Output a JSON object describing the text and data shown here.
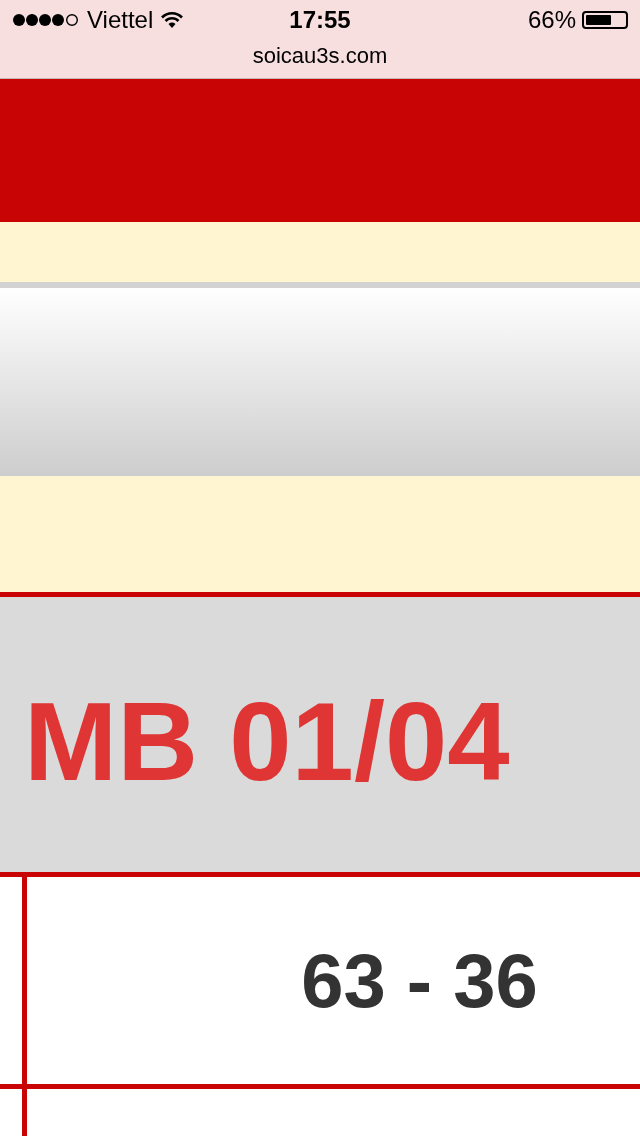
{
  "status_bar": {
    "carrier": "Viettel",
    "time": "17:55",
    "battery": "66%"
  },
  "address_bar": {
    "url": "soicau3s.com"
  },
  "heading": "MB 01/04",
  "table": {
    "rows": [
      {
        "column_2": "63 - 36"
      }
    ]
  }
}
